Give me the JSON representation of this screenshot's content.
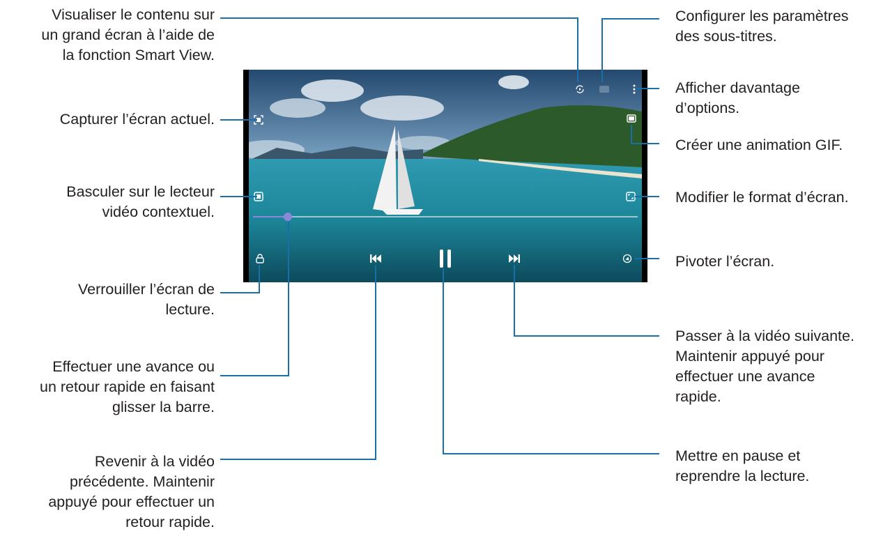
{
  "annotations_left": {
    "smart_view": "Visualiser le contenu sur\nun grand écran à l’aide de\nla fonction Smart View.",
    "capture": "Capturer l’écran actuel.",
    "popup": "Basculer sur le lecteur\nvidéo contextuel.",
    "lock": "Verrouiller l’écran de\nlecture.",
    "seek": "Effectuer une avance ou\nun retour rapide en faisant\nglisser la barre.",
    "previous": "Revenir à la vidéo\nprécédente. Maintenir\nappuyé pour effectuer un\nretour rapide."
  },
  "annotations_right": {
    "subtitles": "Configurer les paramètres\ndes sous-titres.",
    "more": "Afficher davantage\nd’options.",
    "gif": "Créer une animation GIF.",
    "ratio": "Modifier le format d’écran.",
    "rotate": "Pivoter l’écran.",
    "next": "Passer à la vidéo suivante.\nMaintenir appuyé pour\neffectuer une avance\nrapide.",
    "pause": "Mettre en pause et\nreprendre la lecture."
  },
  "player": {
    "progress": 0.09,
    "accent_color": "#8e86d9",
    "icons": [
      "smart-view-icon",
      "subtitles-icon",
      "more-options-icon",
      "capture-icon",
      "gif-icon",
      "popup-player-icon",
      "screen-ratio-icon",
      "lock-icon",
      "previous-icon",
      "pause-icon",
      "next-icon",
      "rotate-icon"
    ]
  },
  "leader_color": "#1a6fa8"
}
